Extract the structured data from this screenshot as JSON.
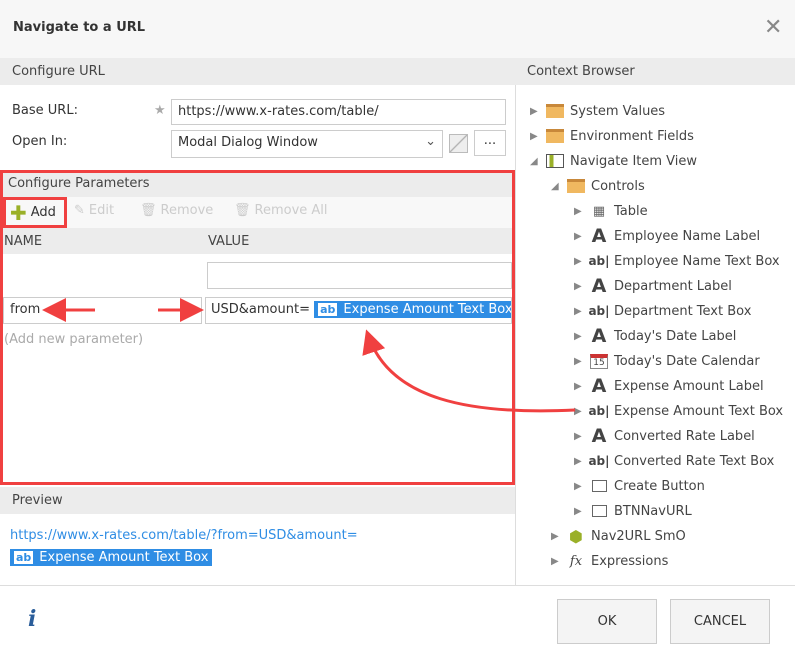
{
  "dialog": {
    "title": "Navigate to a URL",
    "close_icon": "close-icon"
  },
  "configure_url": {
    "header": "Configure URL",
    "base_url_label": "Base URL:",
    "base_url_value": "https://www.x-rates.com/table/",
    "open_in_label": "Open In:",
    "open_in_value": "Modal Dialog Window",
    "more_label": "..."
  },
  "parameters": {
    "header": "Configure Parameters",
    "toolbar": {
      "add": "Add",
      "edit": "Edit",
      "remove": "Remove",
      "remove_all": "Remove All"
    },
    "columns": {
      "name": "NAME",
      "value": "VALUE"
    },
    "row": {
      "name": "from",
      "value_text": "USD&amount=",
      "value_token": "Expense Amount Text Box"
    },
    "add_new": "(Add new parameter)"
  },
  "preview": {
    "header": "Preview",
    "url": "https://www.x-rates.com/table/?from=USD&amount=",
    "token": "Expense Amount Text Box"
  },
  "context_browser": {
    "header": "Context Browser",
    "items": [
      {
        "label": "System Values",
        "icon": "folder-icon",
        "level": 0,
        "expanded": false
      },
      {
        "label": "Environment Fields",
        "icon": "folder-icon",
        "level": 0,
        "expanded": false
      },
      {
        "label": "Navigate Item View",
        "icon": "view-icon",
        "level": 0,
        "expanded": true
      },
      {
        "label": "Controls",
        "icon": "folder-open-icon",
        "level": 1,
        "expanded": true
      },
      {
        "label": "Table",
        "icon": "table-icon",
        "level": 2,
        "expanded": false
      },
      {
        "label": "Employee Name Label",
        "icon": "label-icon",
        "level": 2,
        "expanded": false
      },
      {
        "label": "Employee Name Text Box",
        "icon": "textbox-icon",
        "level": 2,
        "expanded": false
      },
      {
        "label": "Department Label",
        "icon": "label-icon",
        "level": 2,
        "expanded": false
      },
      {
        "label": "Department Text Box",
        "icon": "textbox-icon",
        "level": 2,
        "expanded": false
      },
      {
        "label": "Today's Date Label",
        "icon": "label-icon",
        "level": 2,
        "expanded": false
      },
      {
        "label": "Today's Date Calendar",
        "icon": "calendar-icon",
        "level": 2,
        "expanded": false
      },
      {
        "label": "Expense Amount Label",
        "icon": "label-icon",
        "level": 2,
        "expanded": false
      },
      {
        "label": "Expense Amount Text Box",
        "icon": "textbox-icon",
        "level": 2,
        "expanded": false
      },
      {
        "label": "Converted Rate Label",
        "icon": "label-icon",
        "level": 2,
        "expanded": false
      },
      {
        "label": "Converted Rate Text Box",
        "icon": "textbox-icon",
        "level": 2,
        "expanded": false
      },
      {
        "label": "Create Button",
        "icon": "button-icon",
        "level": 2,
        "expanded": false
      },
      {
        "label": "BTNNavURL",
        "icon": "button-icon",
        "level": 2,
        "expanded": false
      },
      {
        "label": "Nav2URL SmO",
        "icon": "smartobject-icon",
        "level": 1,
        "expanded": false
      },
      {
        "label": "Expressions",
        "icon": "fx-icon",
        "level": 1,
        "expanded": false
      }
    ]
  },
  "footer": {
    "ok": "OK",
    "cancel": "CANCEL",
    "info_icon": "info-icon"
  },
  "colors": {
    "accent": "#2f8de4",
    "annotation": "#f04040"
  }
}
